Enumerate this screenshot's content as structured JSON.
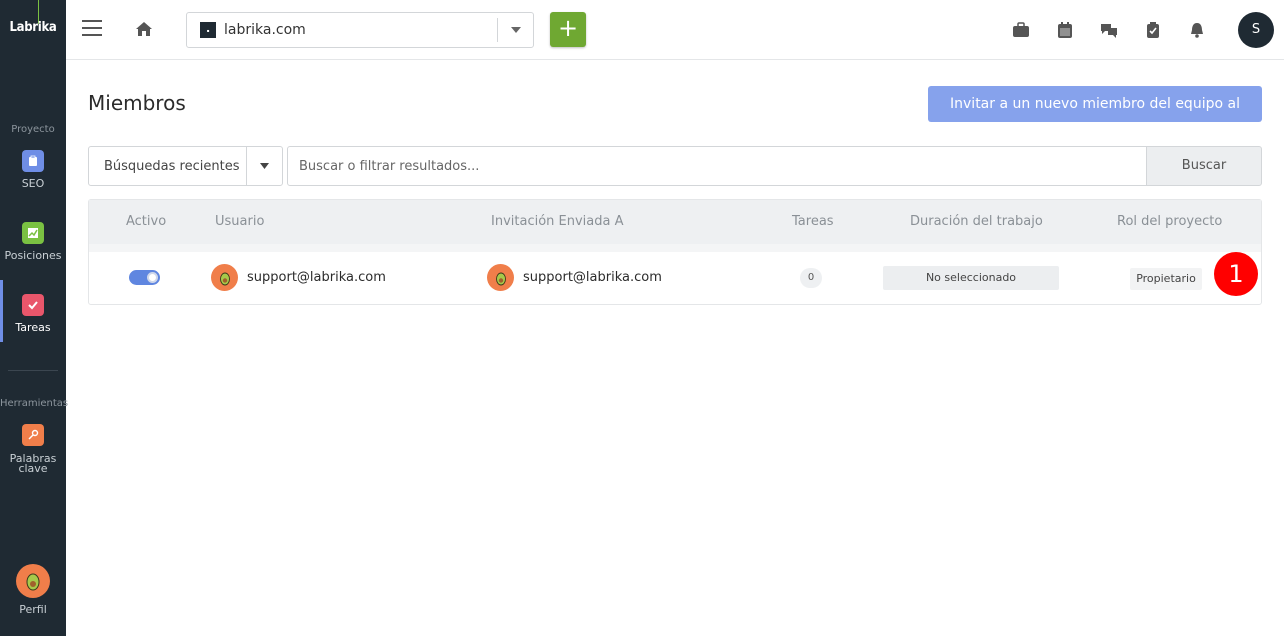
{
  "sidebar": {
    "logo": "Labrika",
    "section_project": "Proyecto",
    "items": [
      {
        "label": "SEO",
        "color": "#6f8ee6"
      },
      {
        "label": "Posiciones",
        "color": "#7ac142"
      },
      {
        "label": "Tareas",
        "color": "#e9566b"
      }
    ],
    "section_tools": "Herramientas",
    "tools": [
      {
        "label": "Palabras clave",
        "color": "#f07e4a"
      }
    ],
    "profile_label": "Perfil"
  },
  "topbar": {
    "site": "labrika.com",
    "add_label": "+",
    "user_initial": "S",
    "icons": [
      "briefcase-icon",
      "calendar-icon",
      "chat-icon",
      "clipboard-icon",
      "bell-icon"
    ]
  },
  "page": {
    "title": "Miembros",
    "invite_label": "Invitar a un nuevo miembro del equipo al proyecto",
    "recent_searches": "Búsquedas recientes",
    "search_placeholder": "Buscar o filtrar resultados...",
    "search_button": "Buscar"
  },
  "table": {
    "columns": [
      "Activo",
      "Usuario",
      "Invitación Enviada A",
      "Tareas",
      "Duración del trabajo",
      "Rol del proyecto"
    ],
    "rows": [
      {
        "active": true,
        "user": "support@labrika.com",
        "invited_to": "support@labrika.com",
        "tasks": "0",
        "duration": "No seleccionado",
        "role": "Propietario"
      }
    ]
  },
  "marker": "1",
  "colors": {
    "sidebar_bg": "#1f2a33",
    "accent": "#86a2ec",
    "add": "#6fa832",
    "marker": "#ff0000"
  }
}
